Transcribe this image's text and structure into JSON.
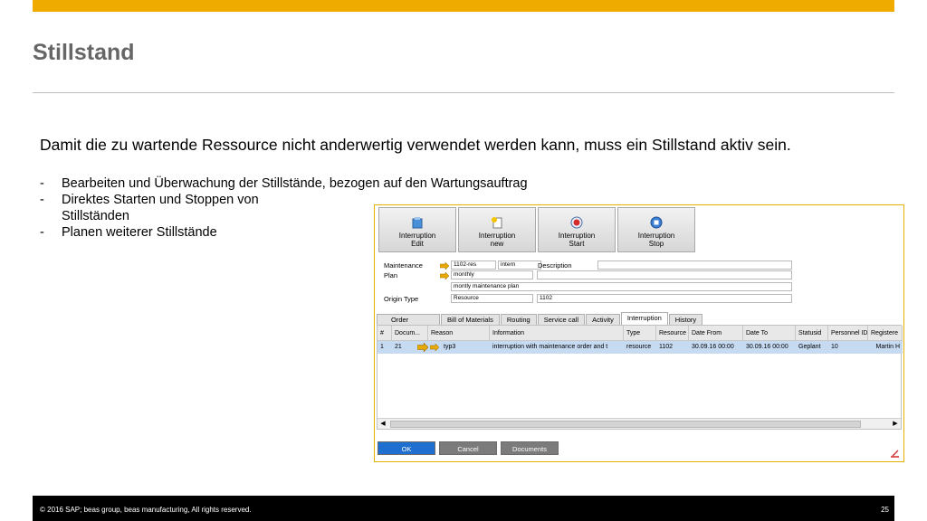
{
  "slide": {
    "title": "Stillstand",
    "intro": "Damit die zu wartende Ressource nicht anderwertig verwendet werden kann, muss ein Stillstand aktiv sein.",
    "bullets": [
      "Bearbeiten und Überwachung der Stillstände, bezogen auf den Wartungsauftrag",
      "Direktes Starten und Stoppen von Stillständen",
      "Planen weiterer Stillstände"
    ],
    "bullet_marker": "-"
  },
  "colors": {
    "accent": "#f0ab00",
    "selection": "#c6daf2",
    "ok_button": "#1f6fd1"
  },
  "toolbar": {
    "buttons": [
      {
        "line1": "Interruption",
        "line2": "Edit",
        "icon": "edit-doc-icon"
      },
      {
        "line1": "Interruption",
        "line2": "new",
        "icon": "new-doc-icon"
      },
      {
        "line1": "Interruption",
        "line2": "Start",
        "icon": "record-start-icon"
      },
      {
        "line1": "Interruption",
        "line2": "Stop",
        "icon": "stop-icon"
      }
    ]
  },
  "form": {
    "maintenance_label": "Maintenance",
    "maintenance_value": "1102-res",
    "maintenance_type": "intern",
    "description_label": "Description",
    "description_value": "",
    "plan_label": "Plan",
    "plan_value": "monthly",
    "plan_description": "montly maintenance plan",
    "origin_label": "Origin Type",
    "origin_value": "Resource",
    "origin_code": "1102"
  },
  "tabs": [
    "Order",
    "Bill of Materials",
    "Routing",
    "Service call",
    "Activity",
    "Interruption",
    "History"
  ],
  "active_tab": "Interruption",
  "grid": {
    "columns": [
      "#",
      "Docum...",
      "Reason",
      "Information",
      "Type",
      "Resource",
      "Date From",
      "Date To",
      "Statusid",
      "Personnel ID",
      "Registere"
    ],
    "rows": [
      [
        "1",
        "21",
        "typ3",
        "interruption with maintenance order and t",
        "resource",
        "1102",
        "30.09.16 00:00",
        "30.09.16 00:00",
        "Geplant",
        "10",
        "Martin H"
      ]
    ]
  },
  "buttons": {
    "ok": "OK",
    "cancel": "Cancel",
    "documents": "Documents"
  },
  "footer": {
    "copyright": "© 2016 SAP; beas group, beas manufacturing,  All rights reserved.",
    "page": "25"
  }
}
